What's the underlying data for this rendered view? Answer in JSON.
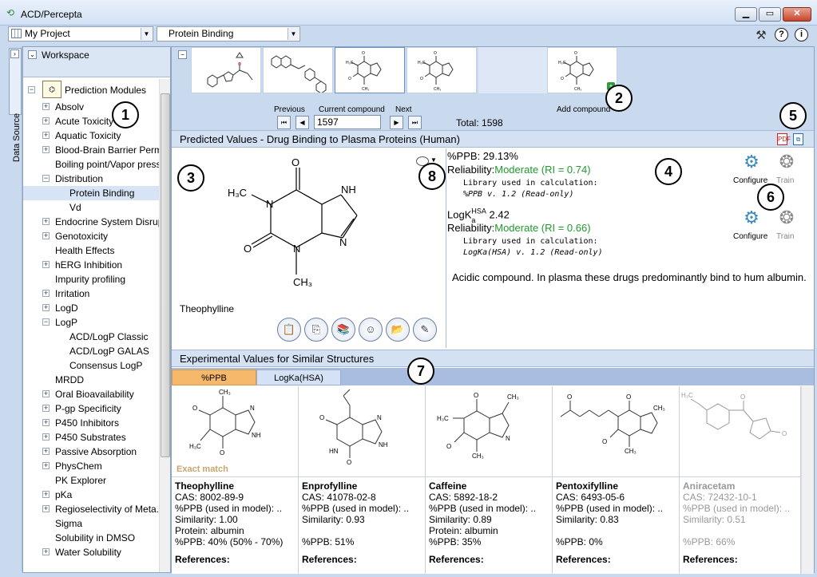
{
  "window": {
    "title": "ACD/Percepta"
  },
  "toolbar": {
    "project": "My Project",
    "module": "Protein Binding"
  },
  "sidebar": {
    "tab_label": "Data Source",
    "workspace_title": "Workspace"
  },
  "tree": {
    "root": "Prediction Modules",
    "items": [
      {
        "label": "Absolv",
        "expander": "+",
        "level": 1
      },
      {
        "label": "Acute Toxicity",
        "expander": "+",
        "level": 1
      },
      {
        "label": "Aquatic Toxicity",
        "expander": "+",
        "level": 1
      },
      {
        "label": "Blood-Brain Barrier Perm...",
        "expander": "+",
        "level": 1
      },
      {
        "label": "Boiling point/Vapor press...",
        "expander": "",
        "level": 1
      },
      {
        "label": "Distribution",
        "expander": "−",
        "level": 1
      },
      {
        "label": "Protein Binding",
        "expander": "",
        "level": 2,
        "selected": true
      },
      {
        "label": "Vd",
        "expander": "",
        "level": 2
      },
      {
        "label": "Endocrine System Disrup...",
        "expander": "+",
        "level": 1
      },
      {
        "label": "Genotoxicity",
        "expander": "+",
        "level": 1
      },
      {
        "label": "Health Effects",
        "expander": "",
        "level": 1
      },
      {
        "label": "hERG Inhibition",
        "expander": "+",
        "level": 1
      },
      {
        "label": "Impurity profiling",
        "expander": "",
        "level": 1
      },
      {
        "label": "Irritation",
        "expander": "+",
        "level": 1
      },
      {
        "label": "LogD",
        "expander": "+",
        "level": 1
      },
      {
        "label": "LogP",
        "expander": "−",
        "level": 1
      },
      {
        "label": "ACD/LogP Classic",
        "expander": "",
        "level": 2
      },
      {
        "label": "ACD/LogP GALAS",
        "expander": "",
        "level": 2
      },
      {
        "label": "Consensus LogP",
        "expander": "",
        "level": 2
      },
      {
        "label": "MRDD",
        "expander": "",
        "level": 1
      },
      {
        "label": "Oral Bioavailability",
        "expander": "+",
        "level": 1
      },
      {
        "label": "P-gp Specificity",
        "expander": "+",
        "level": 1
      },
      {
        "label": "P450 Inhibitors",
        "expander": "+",
        "level": 1
      },
      {
        "label": "P450 Substrates",
        "expander": "+",
        "level": 1
      },
      {
        "label": "Passive Absorption",
        "expander": "+",
        "level": 1
      },
      {
        "label": "PhysChem",
        "expander": "+",
        "level": 1
      },
      {
        "label": "PK Explorer",
        "expander": "",
        "level": 1
      },
      {
        "label": "pKa",
        "expander": "+",
        "level": 1
      },
      {
        "label": "Regioselectivity of Meta...",
        "expander": "+",
        "level": 1
      },
      {
        "label": "Sigma",
        "expander": "",
        "level": 1
      },
      {
        "label": "Solubility in DMSO",
        "expander": "",
        "level": 1
      },
      {
        "label": "Water Solubility",
        "expander": "+",
        "level": 1
      }
    ]
  },
  "navigator": {
    "previous_label": "Previous",
    "current_label": "Current compound",
    "next_label": "Next",
    "current_value": "1597",
    "total": "Total: 1598",
    "add_label": "Add compound"
  },
  "predicted": {
    "header": "Predicted Values - Drug Binding to Plasma Proteins (Human)",
    "compound_name": "Theophylline",
    "ppb_value": "%PPB: 29.13%",
    "reliability_label": "Reliability:",
    "ppb_reliability": "Moderate (RI = 0.74)",
    "library_label": "Library used in calculation:",
    "ppb_library": "%PPB v. 1.2 (Read-only)",
    "logk_label": "LogK",
    "logk_sub": "a",
    "logk_sup": "HSA",
    "logk_value": "2.42",
    "logk_reliability": "Moderate (RI = 0.66)",
    "logk_library": "LogKa(HSA) v. 1.2 (Read-only)",
    "configure_label": "Configure",
    "train_label": "Train",
    "note": "Acidic compound. In plasma these drugs predominantly bind to hum albumin."
  },
  "experimental": {
    "header": "Experimental Values for Similar Structures",
    "tabs": [
      "%PPB",
      "LogKa(HSA)"
    ],
    "exact_match": "Exact match",
    "references_label": "References:",
    "cards": [
      {
        "name": "Theophylline",
        "cas": "CAS: 8002-89-9",
        "ppb_model": "%PPB (used in model): ..",
        "similarity": "Similarity: 1.00",
        "protein": "Protein: albumin",
        "ppb": "%PPB: 40% (50% - 70%)"
      },
      {
        "name": "Enprofylline",
        "cas": "CAS: 41078-02-8",
        "ppb_model": "%PPB (used in model): ..",
        "similarity": "Similarity: 0.93",
        "protein": "",
        "ppb": "%PPB: 51%"
      },
      {
        "name": "Caffeine",
        "cas": "CAS: 5892-18-2",
        "ppb_model": "%PPB (used in model): ..",
        "similarity": "Similarity: 0.89",
        "protein": "Protein: albumin",
        "ppb": "%PPB: 35%"
      },
      {
        "name": "Pentoxifylline",
        "cas": "CAS: 6493-05-6",
        "ppb_model": "%PPB (used in model): ..",
        "similarity": "Similarity: 0.83",
        "protein": "",
        "ppb": "%PPB: 0%"
      },
      {
        "name": "Aniracetam",
        "cas": "CAS: 72432-10-1",
        "ppb_model": "%PPB (used in model): ..",
        "similarity": "Similarity: 0.51",
        "protein": "",
        "ppb": "%PPB: 66%"
      }
    ]
  },
  "callouts": [
    "1",
    "2",
    "3",
    "4",
    "5",
    "6",
    "7",
    "8"
  ],
  "colors": {
    "accent": "#d4e1f3",
    "active_tab": "#f6b86a",
    "reliability": "#1e9a2e"
  }
}
